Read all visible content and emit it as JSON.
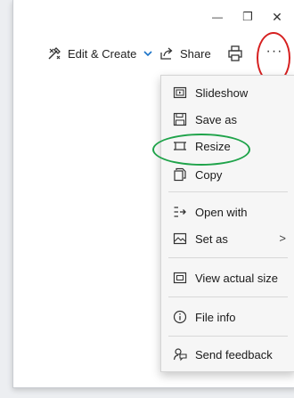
{
  "window_controls": {
    "minimize": "—",
    "restore": "❐",
    "close": "✕"
  },
  "toolbar": {
    "edit_create_label": "Edit & Create",
    "share_label": "Share",
    "more_label": "···"
  },
  "menu": {
    "items": [
      {
        "label": "Slideshow",
        "icon": "slideshow-icon"
      },
      {
        "label": "Save as",
        "icon": "save-icon"
      },
      {
        "label": "Resize",
        "icon": "resize-icon"
      },
      {
        "label": "Copy",
        "icon": "copy-icon"
      },
      {
        "label": "Open with",
        "icon": "open-with-icon"
      },
      {
        "label": "Set as",
        "icon": "set-as-icon",
        "submenu_arrow": ">"
      },
      {
        "label": "View actual size",
        "icon": "actual-size-icon"
      },
      {
        "label": "File info",
        "icon": "info-icon"
      },
      {
        "label": "Send feedback",
        "icon": "feedback-icon"
      }
    ]
  },
  "colors": {
    "highlight_red": "#d62020",
    "highlight_green": "#1fa34a",
    "accent_blue": "#1a73c8"
  }
}
